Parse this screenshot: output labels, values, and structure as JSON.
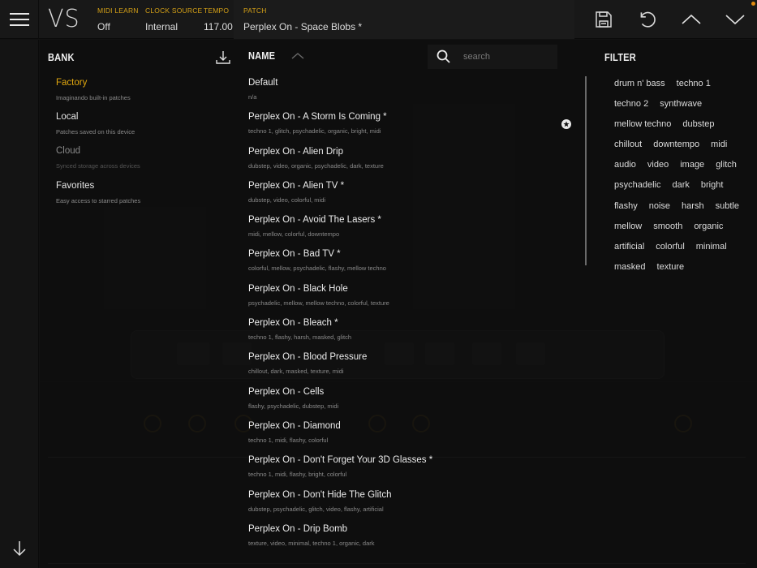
{
  "topbar": {
    "logo": "VS",
    "status": [
      {
        "label": "MIDI LEARN",
        "value": "Off"
      },
      {
        "label": "CLOCK SOURCE",
        "value": "Internal"
      },
      {
        "label": "TEMPO",
        "value": "117.00"
      },
      {
        "label": "PATCH",
        "value": "Perplex On - Space Blobs *"
      }
    ],
    "icons": [
      "menu-icon",
      "save-icon",
      "undo-icon",
      "chevron-up-icon",
      "chevron-down-icon"
    ],
    "notification_color": "#e08a10"
  },
  "bank": {
    "title": "BANK",
    "items": [
      {
        "name": "Factory",
        "desc": "Imaginando built-in patches",
        "state": "selected"
      },
      {
        "name": "Local",
        "desc": "Patches saved on this device",
        "state": "normal"
      },
      {
        "name": "Cloud",
        "desc": "Synced storage across devices",
        "state": "disabled"
      },
      {
        "name": "Favorites",
        "desc": "Easy access to starred patches",
        "state": "normal"
      }
    ]
  },
  "patches": {
    "title": "NAME",
    "search_placeholder": "search",
    "items": [
      {
        "name": "Default",
        "tags": "n/a"
      },
      {
        "name": "Perplex On - A Storm Is Coming *",
        "tags": "techno 1, glitch, psychadelic, organic, bright, midi",
        "starred": true
      },
      {
        "name": "Perplex On - Alien Drip",
        "tags": "dubstep, video, organic, psychadelic, dark, texture"
      },
      {
        "name": "Perplex On - Alien TV *",
        "tags": "dubstep, video, colorful, midi"
      },
      {
        "name": "Perplex On - Avoid The Lasers *",
        "tags": "midi, mellow, colorful, downtempo"
      },
      {
        "name": "Perplex On - Bad TV *",
        "tags": "colorful, mellow, psychadelic, flashy, mellow techno"
      },
      {
        "name": "Perplex On - Black Hole",
        "tags": "psychadelic, mellow, mellow techno, colorful, texture"
      },
      {
        "name": "Perplex On - Bleach *",
        "tags": "techno 1, flashy, harsh, masked, glitch"
      },
      {
        "name": "Perplex On - Blood Pressure",
        "tags": "chillout, dark, masked, texture, midi"
      },
      {
        "name": "Perplex On - Cells",
        "tags": "flashy, psychadelic, dubstep, midi"
      },
      {
        "name": "Perplex On - Diamond",
        "tags": "techno 1, midi, flashy, colorful"
      },
      {
        "name": "Perplex On - Don't Forget Your 3D Glasses *",
        "tags": "techno 1, midi, flashy, bright, colorful"
      },
      {
        "name": "Perplex On - Don't Hide The Glitch",
        "tags": "dubstep, psychadelic, glitch, video, flashy, artificial"
      },
      {
        "name": "Perplex On - Drip Bomb",
        "tags": "texture, video, minimal, techno 1, organic, dark"
      }
    ]
  },
  "filter": {
    "title": "FILTER",
    "tags": [
      "drum n' bass",
      "techno 1",
      "techno 2",
      "synthwave",
      "mellow techno",
      "dubstep",
      "chillout",
      "downtempo",
      "midi",
      "audio",
      "video",
      "image",
      "glitch",
      "psychadelic",
      "dark",
      "bright",
      "flashy",
      "noise",
      "harsh",
      "subtle",
      "mellow",
      "smooth",
      "organic",
      "artificial",
      "colorful",
      "minimal",
      "masked",
      "texture"
    ]
  },
  "colors": {
    "accent": "#e2a80e",
    "background": "#121212"
  }
}
